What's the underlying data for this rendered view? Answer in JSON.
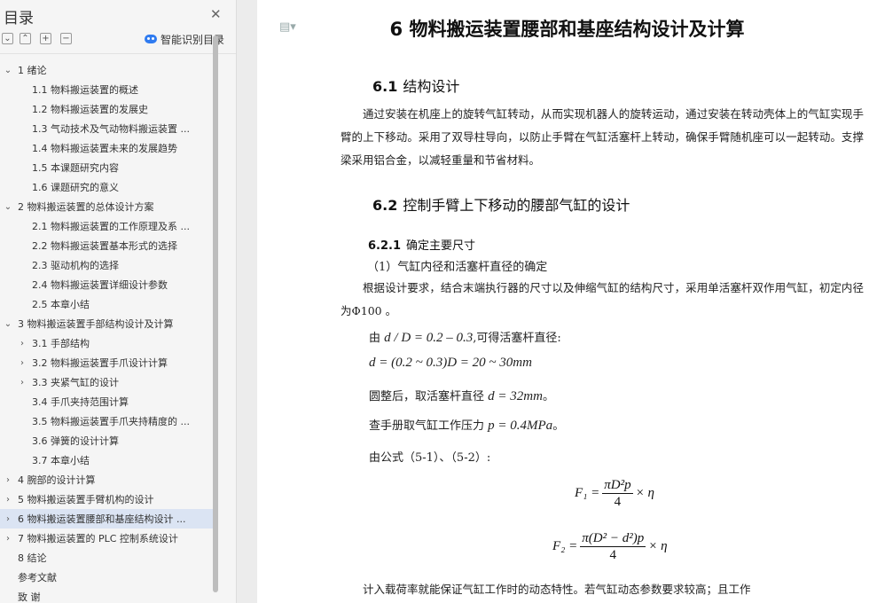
{
  "sidebar": {
    "title": "目录",
    "smart_toc_label": "智能识别目录",
    "items": [
      {
        "label": "1  绪论",
        "level": 0,
        "expanded": true
      },
      {
        "label": "1.1  物料搬运装置的概述",
        "level": 1
      },
      {
        "label": "1.2  物料搬运装置的发展史",
        "level": 1
      },
      {
        "label": "1.3  气动技术及气动物料搬运装置 ...",
        "level": 1
      },
      {
        "label": "1.4  物料搬运装置未来的发展趋势",
        "level": 1
      },
      {
        "label": "1.5  本课题研究内容",
        "level": 1
      },
      {
        "label": "1.6  课题研究的意义",
        "level": 1
      },
      {
        "label": "2  物料搬运装置的总体设计方案",
        "level": 0,
        "expanded": true
      },
      {
        "label": "2.1  物料搬运装置的工作原理及系 ...",
        "level": 1
      },
      {
        "label": "2.2  物料搬运装置基本形式的选择",
        "level": 1
      },
      {
        "label": "2.3  驱动机构的选择",
        "level": 1
      },
      {
        "label": "2.4  物料搬运装置详细设计参数",
        "level": 1
      },
      {
        "label": "2.5  本章小结",
        "level": 1
      },
      {
        "label": "3  物料搬运装置手部结构设计及计算",
        "level": 0,
        "expanded": true
      },
      {
        "label": "3.1  手部结构",
        "level": 1,
        "collapsed": true
      },
      {
        "label": "3.2  物料搬运装置手爪设计计算",
        "level": 1,
        "collapsed": true
      },
      {
        "label": "3.3  夹紧气缸的设计",
        "level": 1,
        "collapsed": true
      },
      {
        "label": "3.4  手爪夹持范围计算",
        "level": 1
      },
      {
        "label": "3.5  物料搬运装置手爪夹持精度的 ...",
        "level": 1
      },
      {
        "label": "3.6  弹簧的设计计算",
        "level": 1
      },
      {
        "label": "3.7  本章小结",
        "level": 1
      },
      {
        "label": "4  腕部的设计计算",
        "level": 0,
        "collapsed": true
      },
      {
        "label": "5  物料搬运装置手臂机构的设计",
        "level": 0,
        "collapsed": true
      },
      {
        "label": "6  物料搬运装置腰部和基座结构设计 ...",
        "level": 0,
        "collapsed": true,
        "selected": true
      },
      {
        "label": "7  物料搬运装置的 PLC 控制系统设计",
        "level": 0,
        "collapsed": true
      },
      {
        "label": "8  结论",
        "level": 0
      },
      {
        "label": "参考文献",
        "level": 0
      },
      {
        "label": "致   谢",
        "level": 0
      }
    ]
  },
  "doc": {
    "title": "6  物料搬运装置腰部和基座结构设计及计算",
    "s61_num": "6.1",
    "s61_title": "结构设计",
    "s61_para": "通过安装在机座上的旋转气缸转动，从而实现机器人的旋转运动，通过安装在转动壳体上的气缸实现手臂的上下移动。采用了双导柱导向，以防止手臂在气缸活塞杆上转动，确保手臂随机座可以一起转动。支撑梁采用铝合金，以减轻重量和节省材料。",
    "s62_num": "6.2",
    "s62_title": "控制手臂上下移动的腰部气缸的设计",
    "s621_num": "6.2.1",
    "s621_title": "确定主要尺寸",
    "p1": "（1）气缸内径和活塞杆直径的确定",
    "p2": "根据设计要求，结合末端执行器的尺寸以及伸缩气缸的结构尺寸，采用单活塞杆双作用气缸，初定内径为Φ100 。",
    "p3_a": "由",
    "p3_math": "d / D = 0.2 – 0.3",
    "p3_b": ",可得活塞杆直径:",
    "p4_math": "d = (0.2 ~ 0.3)D = 20 ~ 30mm",
    "p5_a": "圆整后，取活塞杆直径",
    "p5_math": "d = 32mm",
    "p5_b": "。",
    "p6_a": "查手册取气缸工作压力",
    "p6_math": "p = 0.4MPa",
    "p6_b": "。",
    "p7": "由公式（5-1）、（5-2）:",
    "f1_lhs": "F₁ =",
    "f1_num": "πD²p",
    "f1_den": "4",
    "f1_rhs": "× η",
    "f2_lhs": "F₂ =",
    "f2_num": "π(D² − d²)p",
    "f2_den": "4",
    "f2_rhs": "× η",
    "p8": "计入载荷率就能保证气缸工作时的动态特性。若气缸动态参数要求较高；且工作"
  }
}
